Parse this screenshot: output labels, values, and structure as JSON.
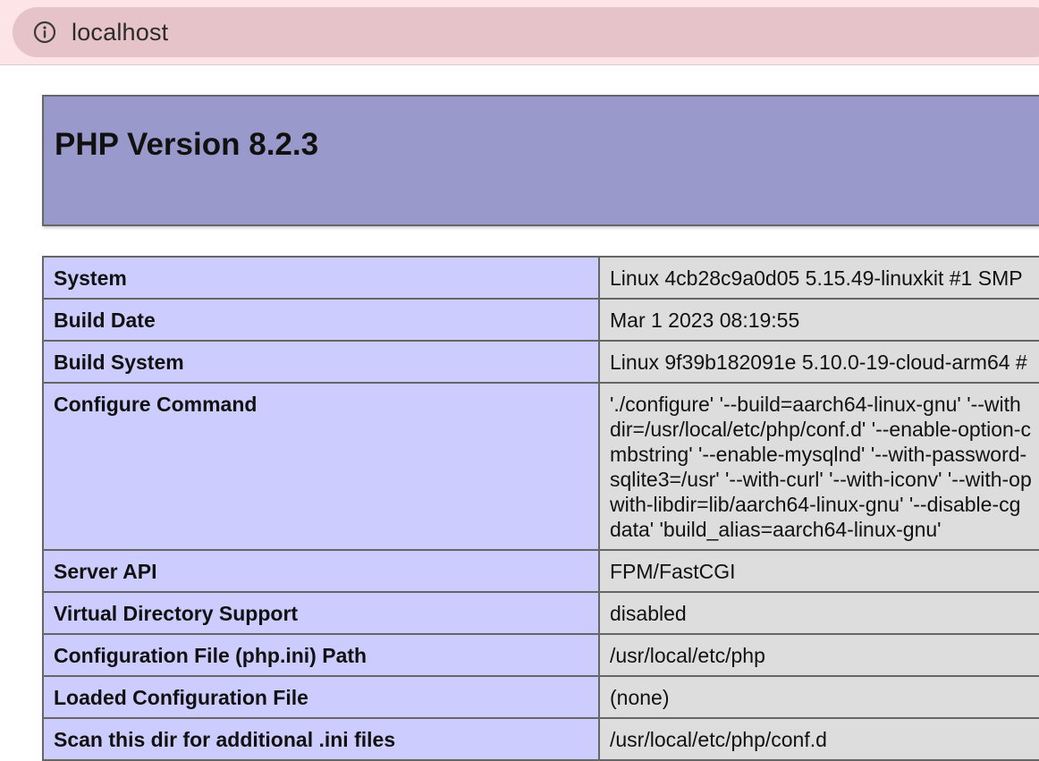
{
  "browser": {
    "address": "localhost",
    "info_icon": "info-circle-icon"
  },
  "page": {
    "title": "PHP Version 8.2.3"
  },
  "rows": [
    {
      "key": "System",
      "value": "Linux 4cb28c9a0d05 5.15.49-linuxkit #1 SMP"
    },
    {
      "key": "Build Date",
      "value": "Mar 1 2023 08:19:55"
    },
    {
      "key": "Build System",
      "value": "Linux 9f39b182091e 5.10.0-19-cloud-arm64 #"
    },
    {
      "key": "Configure Command",
      "value_lines": [
        "'./configure' '--build=aarch64-linux-gnu' '--with",
        "dir=/usr/local/etc/php/conf.d' '--enable-option-c",
        "mbstring' '--enable-mysqlnd' '--with-password-",
        "sqlite3=/usr' '--with-curl' '--with-iconv' '--with-op",
        "with-libdir=lib/aarch64-linux-gnu' '--disable-cg",
        "data' 'build_alias=aarch64-linux-gnu'"
      ]
    },
    {
      "key": "Server API",
      "value": "FPM/FastCGI"
    },
    {
      "key": "Virtual Directory Support",
      "value": "disabled"
    },
    {
      "key": "Configuration File (php.ini) Path",
      "value": "/usr/local/etc/php"
    },
    {
      "key": "Loaded Configuration File",
      "value": "(none)"
    },
    {
      "key": "Scan this dir for additional .ini files",
      "value": "/usr/local/etc/php/conf.d"
    }
  ],
  "colors": {
    "header_bg": "#9999cc",
    "key_bg": "#ccccff",
    "value_bg": "#dddddd",
    "topbar_bg": "#fce4e7"
  }
}
